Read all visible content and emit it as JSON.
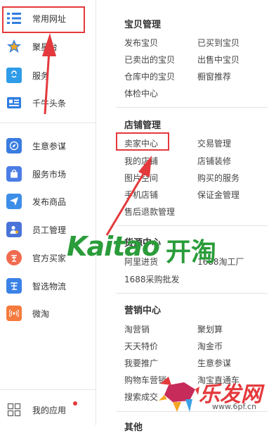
{
  "sidebar": {
    "top_items": [
      {
        "label": "常用网址",
        "icon": "list-icon"
      },
      {
        "label": "聚星台",
        "icon": "star-icon"
      },
      {
        "label": "服务",
        "icon": "shopping-bag-icon"
      },
      {
        "label": "千牛头条",
        "icon": "news-card-icon"
      }
    ],
    "items": [
      {
        "label": "生意参谋",
        "icon": "compass-icon"
      },
      {
        "label": "服务市场",
        "icon": "bag-icon"
      },
      {
        "label": "发布商品",
        "icon": "paper-plane-icon"
      },
      {
        "label": "员工管理",
        "icon": "user-icon"
      },
      {
        "label": "官方买家",
        "icon": "buyer-icon"
      },
      {
        "label": "智选物流",
        "icon": "logistics-icon"
      },
      {
        "label": "微淘",
        "icon": "broadcast-icon"
      }
    ],
    "bottom": {
      "label": "我的应用",
      "icon": "apps-grid-icon"
    }
  },
  "sections": [
    {
      "title": "宝贝管理",
      "links": [
        "发布宝贝",
        "已买到宝贝",
        "已卖出的宝贝",
        "出售中宝贝",
        "仓库中的宝贝",
        "橱窗推荐",
        "体检中心"
      ]
    },
    {
      "title": "店铺管理",
      "links": [
        "卖家中心",
        "交易管理",
        "我的店铺",
        "店铺装修",
        "图片空间",
        "购买的服务",
        "手机店铺",
        "保证金管理",
        "售后退款管理"
      ]
    },
    {
      "title": "货源中心",
      "links": [
        "阿里进货",
        "1688淘工厂",
        "1688采购批发"
      ]
    },
    {
      "title": "营销中心",
      "links": [
        "淘营销",
        "聚划算",
        "天天特价",
        "淘金币",
        "我要推广",
        "生意参谋",
        "购物车营销",
        "淘宝直通车",
        "搜索成交"
      ]
    },
    {
      "title": "其他"
    }
  ],
  "watermarks": {
    "kaitao_latin": "Kaitao",
    "kaitao_cn": "开淘",
    "site_cn": "乐发网",
    "site_url": "www.6pf.cn"
  },
  "colors": {
    "highlight": "#e4393c",
    "notify_dot": "#e4393c"
  }
}
